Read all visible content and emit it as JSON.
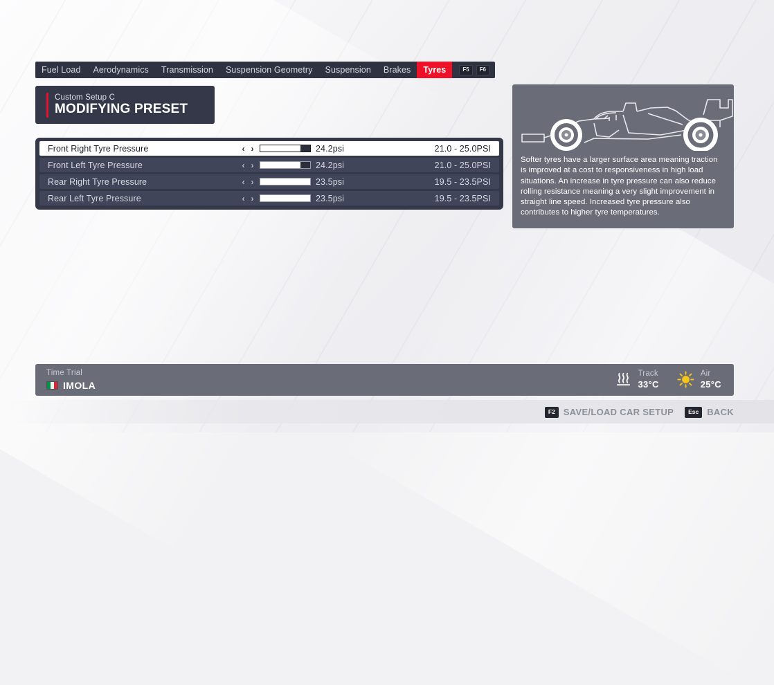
{
  "tabs": [
    {
      "label": "Fuel Load",
      "active": false
    },
    {
      "label": "Aerodynamics",
      "active": false
    },
    {
      "label": "Transmission",
      "active": false
    },
    {
      "label": "Suspension Geometry",
      "active": false
    },
    {
      "label": "Suspension",
      "active": false
    },
    {
      "label": "Brakes",
      "active": false
    },
    {
      "label": "Tyres",
      "active": true
    }
  ],
  "tab_keys": [
    "F5",
    "F6"
  ],
  "preset": {
    "subtitle": "Custom Setup  C",
    "title": "MODIFYING PRESET",
    "accent_color": "#e31330"
  },
  "settings": {
    "rows": [
      {
        "label": "Front Right Tyre Pressure",
        "value": "24.2psi",
        "range": "21.0 - 25.0PSI",
        "fill_percent": 80,
        "selected": true
      },
      {
        "label": "Front Left Tyre Pressure",
        "value": "24.2psi",
        "range": "21.0 - 25.0PSI",
        "fill_percent": 80,
        "selected": false
      },
      {
        "label": "Rear Right Tyre Pressure",
        "value": "23.5psi",
        "range": "19.5 - 23.5PSI",
        "fill_percent": 100,
        "selected": false
      },
      {
        "label": "Rear Left Tyre Pressure",
        "value": "23.5psi",
        "range": "19.5 - 23.5PSI",
        "fill_percent": 100,
        "selected": false
      }
    ],
    "decrease_arrow": "‹",
    "increase_arrow": "›"
  },
  "info": {
    "description": "Softer tyres have a larger surface area meaning traction is improved at a cost to responsiveness in high load situations. An increase in tyre pressure can also reduce rolling resistance meaning a very slight improvement in straight line speed. Increased tyre pressure also contributes to higher tyre temperatures."
  },
  "session": {
    "mode": "Time Trial",
    "track": "IMOLA",
    "weather": [
      {
        "icon": "heat-waves-icon",
        "label": "Track",
        "value": "33°C"
      },
      {
        "icon": "sun-icon",
        "label": "Air",
        "value": "25°C"
      }
    ]
  },
  "footer": {
    "actions": [
      {
        "key": "F2",
        "label": "SAVE/LOAD CAR SETUP"
      },
      {
        "key": "Esc",
        "label": "BACK"
      }
    ]
  }
}
